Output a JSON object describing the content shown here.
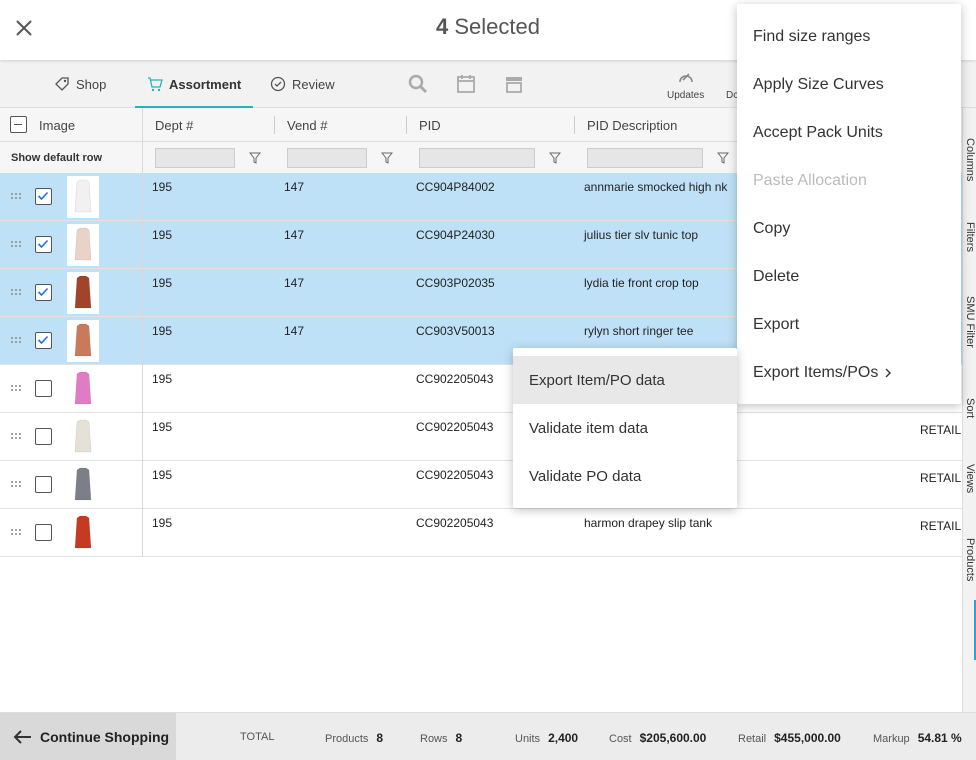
{
  "header": {
    "selected_count": "4",
    "selected_label": "Selected"
  },
  "toolbar": {
    "tabs": [
      {
        "label": "Shop",
        "icon": "tag-icon"
      },
      {
        "label": "Assortment",
        "icon": "cart-icon"
      },
      {
        "label": "Review",
        "icon": "check-circle-icon"
      }
    ],
    "updates_label": "Updates",
    "partial_label": "Dc"
  },
  "grid": {
    "columns": [
      "Image",
      "Dept #",
      "Vend #",
      "PID",
      "PID Description"
    ],
    "show_default_row": "Show default row",
    "rows": [
      {
        "selected": true,
        "dept": "195",
        "vend": "147",
        "pid": "CC904P84002",
        "desc": "annmarie smocked high nk",
        "extra": "",
        "thumb": "#f1f1f1"
      },
      {
        "selected": true,
        "dept": "195",
        "vend": "147",
        "pid": "CC904P24030",
        "desc": "julius tier slv tunic top",
        "extra": "",
        "thumb": "#e9d3c8"
      },
      {
        "selected": true,
        "dept": "195",
        "vend": "147",
        "pid": "CC903P02035",
        "desc": "lydia tie front crop top",
        "extra": "",
        "thumb": "#a2442c"
      },
      {
        "selected": true,
        "dept": "195",
        "vend": "147",
        "pid": "CC903V50013",
        "desc": "rylyn short ringer tee",
        "extra": "",
        "thumb": "#c87a5a"
      },
      {
        "selected": false,
        "dept": "195",
        "vend": "",
        "pid": "CC902205043",
        "desc": "",
        "extra": "",
        "thumb": "#e07cc4"
      },
      {
        "selected": false,
        "dept": "195",
        "vend": "",
        "pid": "CC902205043",
        "desc": "",
        "extra": "RETAIL",
        "thumb": "#e6e1d6"
      },
      {
        "selected": false,
        "dept": "195",
        "vend": "",
        "pid": "CC902205043",
        "desc": "",
        "extra": "RETAIL",
        "thumb": "#7d7f88"
      },
      {
        "selected": false,
        "dept": "195",
        "vend": "",
        "pid": "CC902205043",
        "desc": "harmon drapey slip tank",
        "extra": "RETAIL",
        "thumb": "#c63a24"
      }
    ]
  },
  "siderail": [
    "Columns",
    "Filters",
    "SMU Filter",
    "Sort",
    "Views",
    "Products"
  ],
  "footer": {
    "continue_label": "Continue Shopping",
    "total_label": "TOTAL",
    "products_label": "Products",
    "products_value": "8",
    "rows_label": "Rows",
    "rows_value": "8",
    "units_label": "Units",
    "units_value": "2,400",
    "cost_label": "Cost",
    "cost_value": "$205,600.00",
    "retail_label": "Retail",
    "retail_value": "$455,000.00",
    "markup_label": "Markup",
    "markup_value": "54.81 %"
  },
  "context_menu": {
    "items": [
      {
        "label": "Find size ranges",
        "disabled": false
      },
      {
        "label": "Apply Size Curves",
        "disabled": false
      },
      {
        "label": "Accept Pack Units",
        "disabled": false
      },
      {
        "label": "Paste Allocation",
        "disabled": true
      },
      {
        "label": "Copy",
        "disabled": false
      },
      {
        "label": "Delete",
        "disabled": false
      },
      {
        "label": "Export",
        "disabled": false
      },
      {
        "label": "Export Items/POs",
        "disabled": false,
        "submenu": true
      }
    ],
    "submenu_items": [
      "Export Item/PO data",
      "Validate item data",
      "Validate PO data"
    ]
  }
}
